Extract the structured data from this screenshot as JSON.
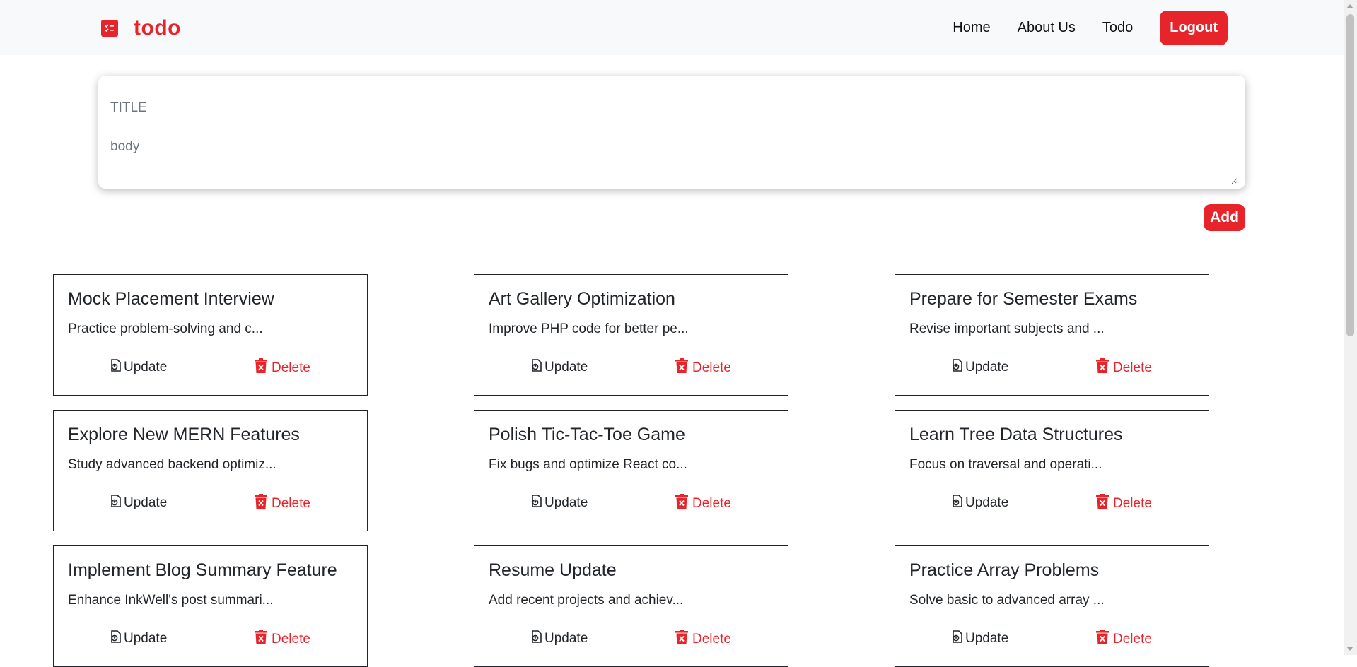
{
  "colors": {
    "accent": "#e8242b",
    "navbar_bg": "#f8f9fa",
    "text": "#212529"
  },
  "navbar": {
    "brand_icon": "checklist-icon",
    "brand": "todo",
    "links": [
      "Home",
      "About Us",
      "Todo"
    ],
    "logout": "Logout"
  },
  "form": {
    "title_placeholder": "TITLE",
    "body_placeholder": "body",
    "add": "Add"
  },
  "actions": {
    "update": "Update",
    "delete": "Delete",
    "update_icon": "update-icon",
    "delete_icon": "trash-icon"
  },
  "todos": [
    {
      "title": "Mock Placement Interview",
      "body": "Practice problem-solving and c..."
    },
    {
      "title": "Art Gallery Optimization",
      "body": "Improve PHP code for better pe..."
    },
    {
      "title": "Prepare for Semester Exams",
      "body": "Revise important subjects and ..."
    },
    {
      "title": "Explore New MERN Features",
      "body": "Study advanced backend optimiz..."
    },
    {
      "title": "Polish Tic-Tac-Toe Game",
      "body": "Fix bugs and optimize React co..."
    },
    {
      "title": "Learn Tree Data Structures",
      "body": "Focus on traversal and operati..."
    },
    {
      "title": "Implement Blog Summary Feature",
      "body": "Enhance InkWell's post summari..."
    },
    {
      "title": "Resume Update",
      "body": "Add recent projects and achiev..."
    },
    {
      "title": "Practice Array Problems",
      "body": "Solve basic to advanced array ..."
    }
  ]
}
